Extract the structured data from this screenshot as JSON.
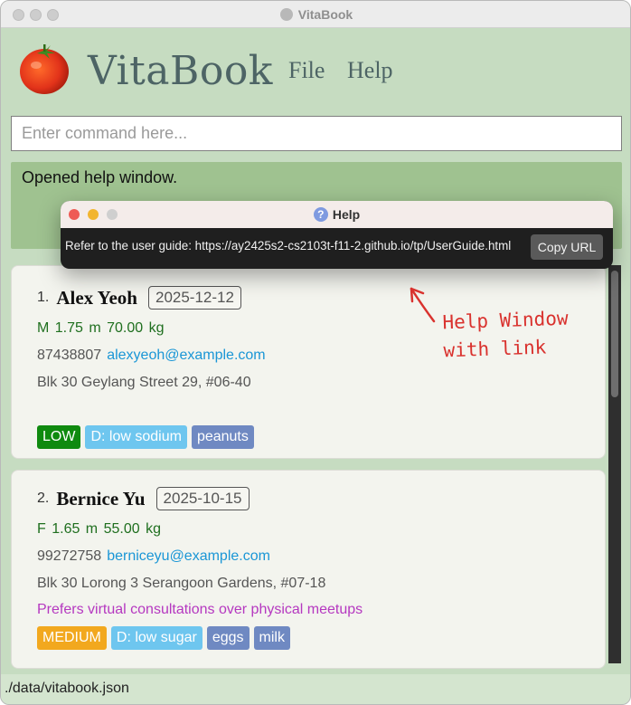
{
  "window": {
    "title": "VitaBook"
  },
  "header": {
    "app_name": "VitaBook",
    "menus": [
      "File",
      "Help"
    ]
  },
  "command_box": {
    "placeholder": "Enter command here...",
    "value": ""
  },
  "result_display": {
    "text": "Opened help window."
  },
  "persons": [
    {
      "index": "1.",
      "name": "Alex Yeoh",
      "date": "2025-12-12",
      "vitals": "M 1.75 m 70.00 kg",
      "phone": "87438807",
      "email": "alexyeoh@example.com",
      "address": "Blk 30 Geylang Street 29, #06-40",
      "remark": "",
      "tags": [
        {
          "label": "LOW",
          "kind": "priority-low",
          "color": "#0f8a0f"
        },
        {
          "label": "D: low sodium",
          "kind": "diet",
          "color": "#6ec6ef"
        },
        {
          "label": "peanuts",
          "kind": "allergy",
          "color": "#6f89c2"
        }
      ]
    },
    {
      "index": "2.",
      "name": "Bernice Yu",
      "date": "2025-10-15",
      "vitals": "F 1.65 m 55.00 kg",
      "phone": "99272758",
      "email": "berniceyu@example.com",
      "address": "Blk 30 Lorong 3 Serangoon Gardens, #07-18",
      "remark": "Prefers virtual consultations over physical meetups",
      "tags": [
        {
          "label": "MEDIUM",
          "kind": "priority-medium",
          "color": "#f2a81e"
        },
        {
          "label": "D: low sugar",
          "kind": "diet",
          "color": "#6ec6ef"
        },
        {
          "label": "eggs",
          "kind": "allergy",
          "color": "#6f89c2"
        },
        {
          "label": "milk",
          "kind": "allergy",
          "color": "#6f89c2"
        }
      ]
    }
  ],
  "help_window": {
    "title": "Help",
    "message": "Refer to the user guide: https://ay2425s2-cs2103t-f11-2.github.io/tp/UserGuide.html",
    "copy_button": "Copy URL"
  },
  "annotation": {
    "line1": "Help Window",
    "line2": "with link"
  },
  "status_bar": {
    "path": "./data/vitabook.json"
  },
  "colors": {
    "background": "#c6dcc1",
    "result_background": "#9fc290",
    "accent_text": "#4d6465",
    "annotation": "#d9322e"
  }
}
